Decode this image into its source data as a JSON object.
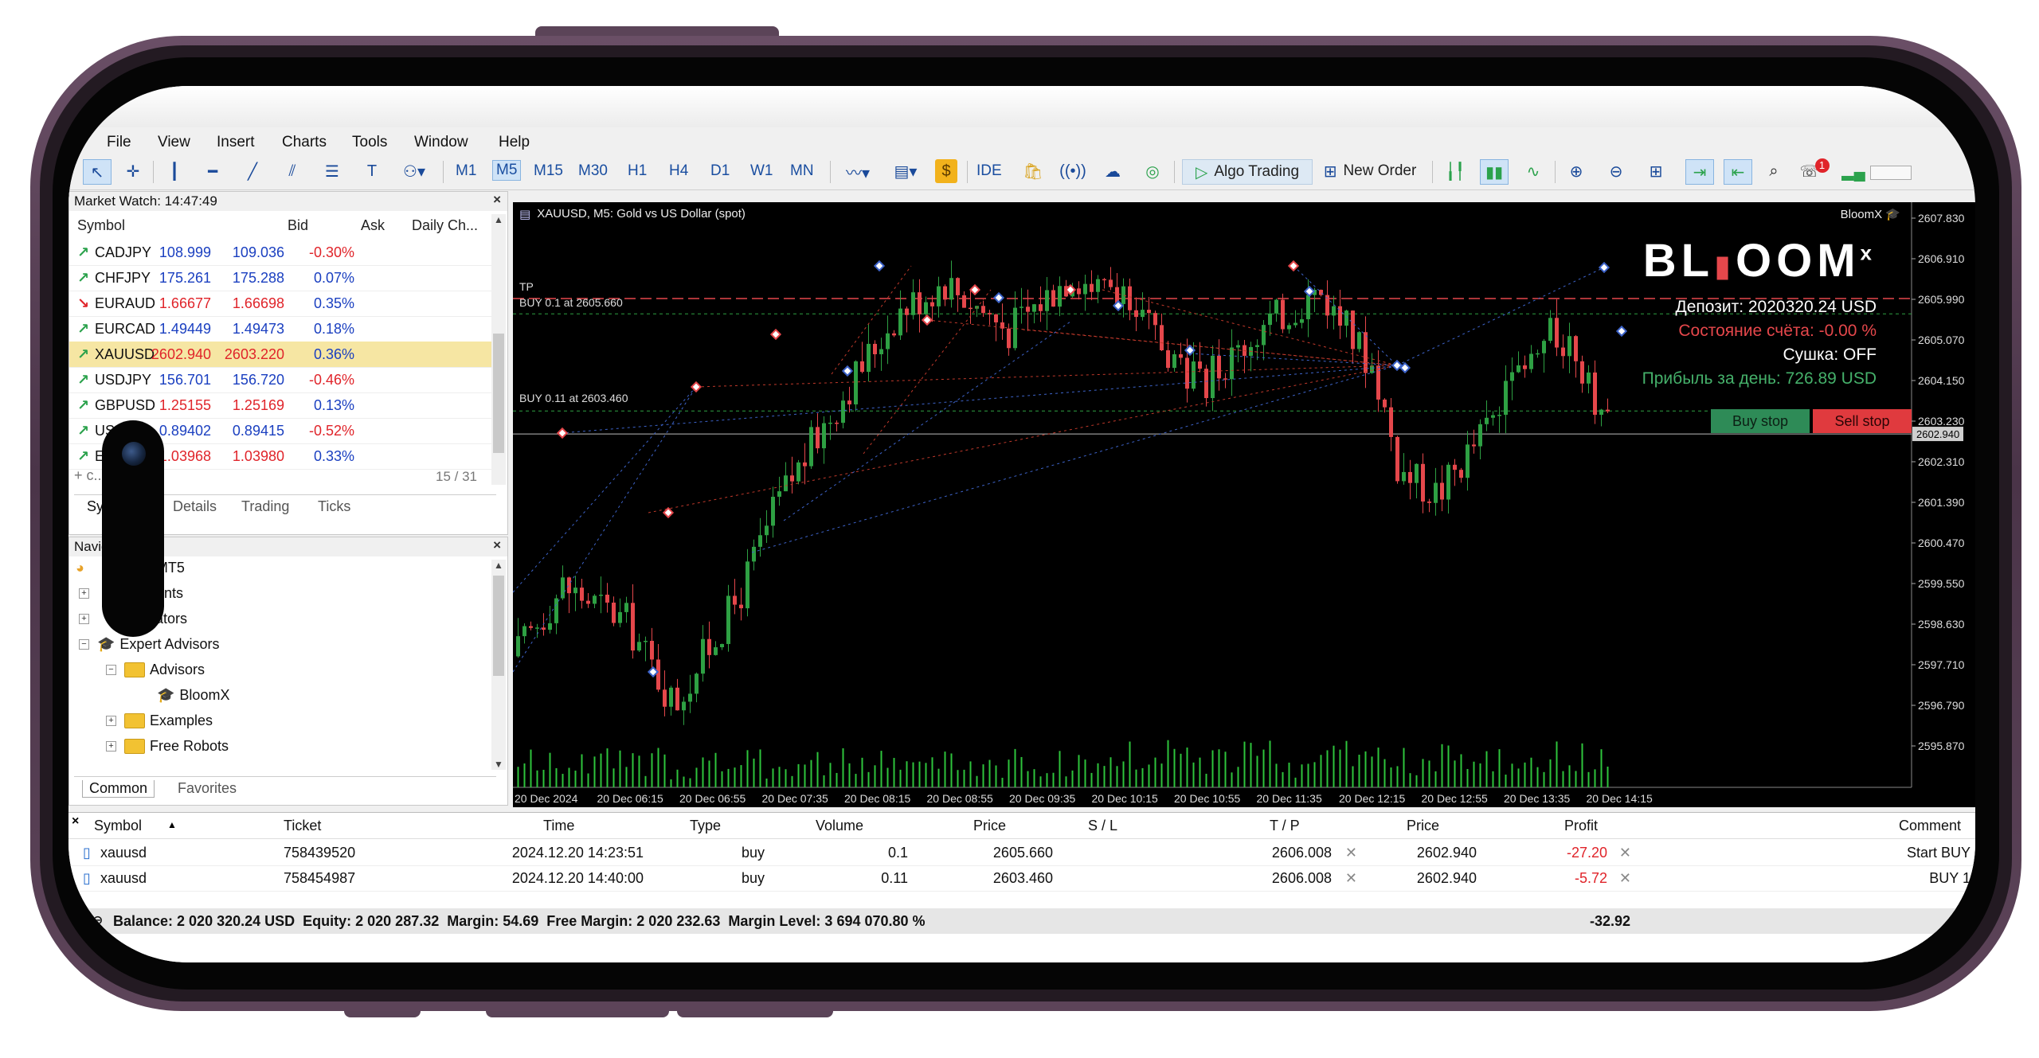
{
  "menu": [
    "File",
    "View",
    "Insert",
    "Charts",
    "Tools",
    "Window",
    "Help"
  ],
  "toolbar": {
    "timeframes": [
      "M1",
      "M5",
      "M15",
      "M30",
      "H1",
      "H4",
      "D1",
      "W1",
      "MN"
    ],
    "selected_timeframe": "M5",
    "ide": "IDE",
    "algo_trading": "Algo Trading",
    "new_order": "New Order",
    "notification_count": "1"
  },
  "market_watch": {
    "title": "Market Watch: 14:47:49",
    "headers": {
      "symbol": "Symbol",
      "bid": "Bid",
      "ask": "Ask",
      "change": "Daily Ch..."
    },
    "rows": [
      {
        "symbol": "CADJPY",
        "bid": "108.999",
        "ask": "109.036",
        "change": "-0.30%",
        "dir": "up",
        "bid_color": "#1a3fc0",
        "ask_color": "#1a3fc0",
        "change_color": "#e0242a",
        "highlight": false
      },
      {
        "symbol": "CHFJPY",
        "bid": "175.261",
        "ask": "175.288",
        "change": "0.07%",
        "dir": "up",
        "bid_color": "#1a3fc0",
        "ask_color": "#1a3fc0",
        "change_color": "#1a3fc0",
        "highlight": false
      },
      {
        "symbol": "EURAUD",
        "bid": "1.66677",
        "ask": "1.66698",
        "change": "0.35%",
        "dir": "down",
        "bid_color": "#e0242a",
        "ask_color": "#e0242a",
        "change_color": "#1a3fc0",
        "highlight": false
      },
      {
        "symbol": "EURCAD",
        "bid": "1.49449",
        "ask": "1.49473",
        "change": "0.18%",
        "dir": "up",
        "bid_color": "#1a3fc0",
        "ask_color": "#1a3fc0",
        "change_color": "#1a3fc0",
        "highlight": false
      },
      {
        "symbol": "XAUUSD",
        "bid": "2602.940",
        "ask": "2603.220",
        "change": "0.36%",
        "dir": "up",
        "bid_color": "#e0242a",
        "ask_color": "#e0242a",
        "change_color": "#1a3fc0",
        "highlight": true
      },
      {
        "symbol": "USDJPY",
        "bid": "156.701",
        "ask": "156.720",
        "change": "-0.46%",
        "dir": "up",
        "bid_color": "#1a3fc0",
        "ask_color": "#1a3fc0",
        "change_color": "#e0242a",
        "highlight": false
      },
      {
        "symbol": "GBPUSD",
        "bid": "1.25155",
        "ask": "1.25169",
        "change": "0.13%",
        "dir": "up",
        "bid_color": "#e0242a",
        "ask_color": "#e0242a",
        "change_color": "#1a3fc0",
        "highlight": false
      },
      {
        "symbol": "US",
        "bid": "0.89402",
        "ask": "0.89415",
        "change": "-0.52%",
        "dir": "up",
        "bid_color": "#1a3fc0",
        "ask_color": "#1a3fc0",
        "change_color": "#e0242a",
        "highlight": false
      },
      {
        "symbol": "E",
        "bid": "1.03968",
        "ask": "1.03980",
        "change": "0.33%",
        "dir": "up",
        "bid_color": "#e0242a",
        "ask_color": "#e0242a",
        "change_color": "#1a3fc0",
        "highlight": false
      }
    ],
    "add_placeholder": "+ c...d...",
    "count": "15 / 31",
    "tabs": [
      "Sy",
      "Details",
      "Trading",
      "Ticks"
    ]
  },
  "navigator": {
    "title": "Navig",
    "items": [
      "ex MT5",
      "ounts",
      "cators",
      "Expert Advisors",
      "Advisors",
      "BloomX",
      "Examples",
      "Free Robots"
    ],
    "tabs": [
      "Common",
      "Favorites"
    ]
  },
  "chart": {
    "title": "XAUUSD, M5:  Gold vs US Dollar (spot)",
    "ea_name": "BloomX",
    "tp_label": "TP",
    "buy_label_1": "BUY 0.1 at 2605.660",
    "buy_label_2": "BUY 0.11 at 2603.460",
    "current_price": "2602.940",
    "y_labels": [
      "2607.830",
      "2606.910",
      "2605.990",
      "2605.070",
      "2604.150",
      "2603.230",
      "2602.310",
      "2601.390",
      "2600.470",
      "2599.550",
      "2598.630",
      "2597.710",
      "2596.790",
      "2595.870"
    ],
    "x_labels": [
      "20 Dec 2024",
      "20 Dec 06:15",
      "20 Dec 06:55",
      "20 Dec 07:35",
      "20 Dec 08:15",
      "20 Dec 08:55",
      "20 Dec 09:35",
      "20 Dec 10:15",
      "20 Dec 10:55",
      "20 Dec 11:35",
      "20 Dec 12:15",
      "20 Dec 12:55",
      "20 Dec 13:35",
      "20 Dec 14:15"
    ],
    "logo_main": "BL",
    "logo_rest": "OOM",
    "logo_x": "x",
    "deposit": "Депозит: 2020320.24 USD",
    "account_state": "Состояние счёта: -0.00 %",
    "drying": "Сушка: OFF",
    "profit_day": "Прибыль за день: 726.89 USD",
    "buy_stop": "Buy stop",
    "sell_stop": "Sell stop",
    "colors": {
      "bull": "#2ea043",
      "bear": "#e5474b",
      "volume": "#2ec43c",
      "profit_text": "#45b06a",
      "state_text": "#e5474b"
    }
  },
  "trade": {
    "headers": [
      "Symbol",
      "Ticket",
      "Time",
      "Type",
      "Volume",
      "Price",
      "S / L",
      "T / P",
      "Price",
      "Profit",
      "Comment"
    ],
    "rows": [
      {
        "symbol": "xauusd",
        "ticket": "758439520",
        "time": "2024.12.20 14:23:51",
        "type": "buy",
        "volume": "0.1",
        "price": "2605.660",
        "sl": "",
        "tp": "2606.008",
        "cur": "2602.940",
        "profit": "-27.20",
        "comment": "Start BUY"
      },
      {
        "symbol": "xauusd",
        "ticket": "758454987",
        "time": "2024.12.20 14:40:00",
        "type": "buy",
        "volume": "0.11",
        "price": "2603.460",
        "sl": "",
        "tp": "2606.008",
        "cur": "2602.940",
        "profit": "-5.72",
        "comment": "BUY 1"
      }
    ],
    "balance_line": "Balance: 2 020 320.24 USD  Equity: 2 020 287.32  Margin: 54.69  Free Margin: 2 020 232.63  Margin Level: 3 694 070.80 %",
    "total_profit": "-32.92"
  }
}
